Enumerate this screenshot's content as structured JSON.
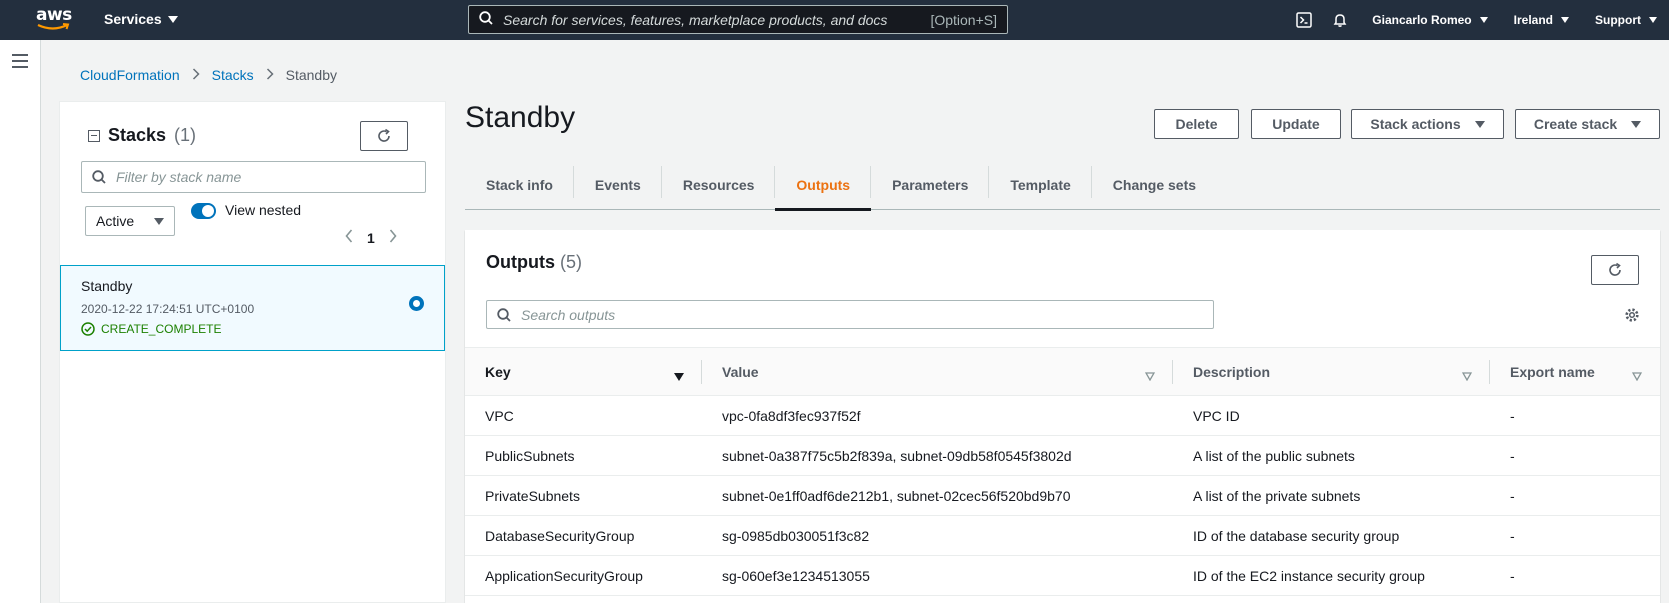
{
  "topnav": {
    "logo_text": "aws",
    "services_label": "Services",
    "search_placeholder": "Search for services, features, marketplace products, and docs",
    "search_shortcut": "[Option+S]",
    "user_label": "Giancarlo Romeo",
    "region_label": "Ireland",
    "support_label": "Support"
  },
  "breadcrumb": {
    "items": [
      "CloudFormation",
      "Stacks",
      "Standby"
    ]
  },
  "stacks_panel": {
    "title": "Stacks",
    "count": "(1)",
    "filter_placeholder": "Filter by stack name",
    "status_filter": "Active",
    "view_nested_label": "View nested",
    "view_nested_on": true,
    "page": "1",
    "stacks": [
      {
        "name": "Standby",
        "timestamp": "2020-12-22 17:24:51 UTC+0100",
        "status": "CREATE_COMPLETE",
        "selected": true
      }
    ]
  },
  "main": {
    "title": "Standby",
    "buttons": {
      "delete": "Delete",
      "update": "Update",
      "stack_actions": "Stack actions",
      "create_stack": "Create stack"
    },
    "tabs": [
      {
        "label": "Stack info",
        "active": false
      },
      {
        "label": "Events",
        "active": false
      },
      {
        "label": "Resources",
        "active": false
      },
      {
        "label": "Outputs",
        "active": true
      },
      {
        "label": "Parameters",
        "active": false
      },
      {
        "label": "Template",
        "active": false
      },
      {
        "label": "Change sets",
        "active": false
      }
    ],
    "outputs": {
      "title": "Outputs",
      "count": "(5)",
      "search_placeholder": "Search outputs",
      "columns": [
        "Key",
        "Value",
        "Description",
        "Export name"
      ],
      "rows": [
        {
          "key": "VPC",
          "value": "vpc-0fa8df3fec937f52f",
          "description": "VPC ID",
          "export": "-"
        },
        {
          "key": "PublicSubnets",
          "value": "subnet-0a387f75c5b2f839a, subnet-09db58f0545f3802d",
          "description": "A list of the public subnets",
          "export": "-"
        },
        {
          "key": "PrivateSubnets",
          "value": "subnet-0e1ff0adf6de212b1, subnet-02cec56f520bd9b70",
          "description": "A list of the private subnets",
          "export": "-"
        },
        {
          "key": "DatabaseSecurityGroup",
          "value": "sg-0985db030051f3c82",
          "description": "ID of the database security group",
          "export": "-"
        },
        {
          "key": "ApplicationSecurityGroup",
          "value": "sg-060ef3e1234513055",
          "description": "ID of the EC2 instance security group",
          "export": "-"
        }
      ]
    }
  },
  "colors": {
    "nav_bg": "#232f3e",
    "link": "#0073bb",
    "active_tab": "#ec7211",
    "success": "#1d8102"
  }
}
